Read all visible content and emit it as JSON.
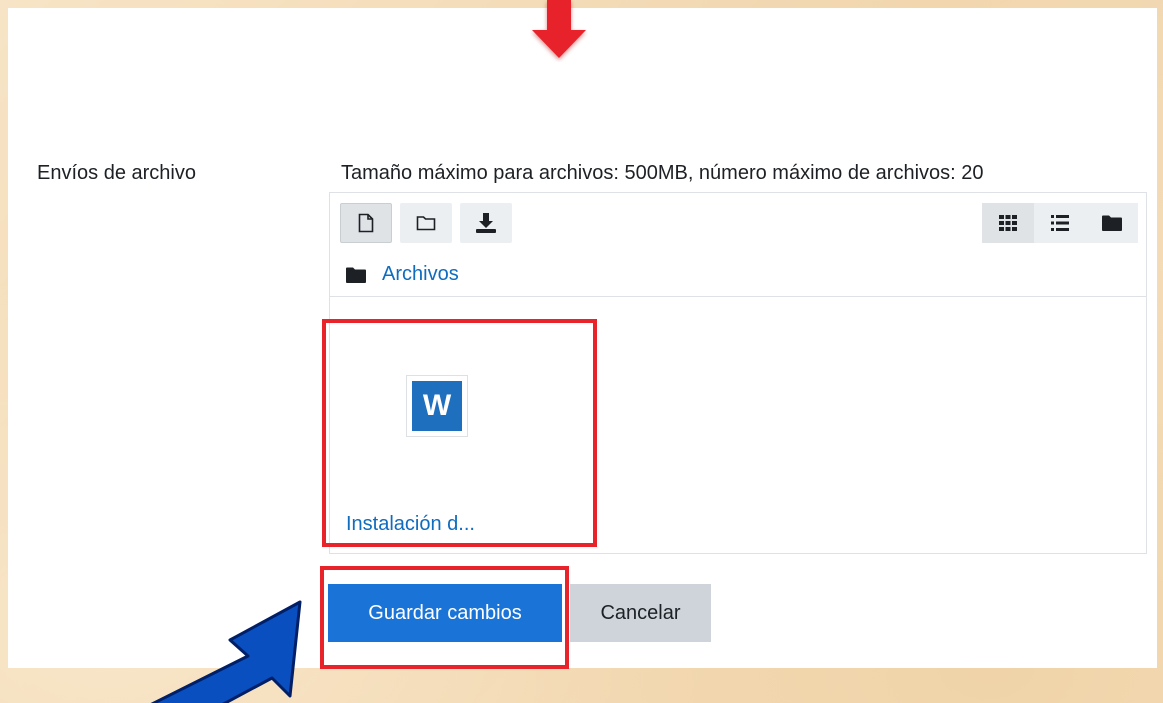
{
  "field": {
    "label": "Envíos de archivo",
    "max_info": "Tamaño máximo para archivos: 500MB, número máximo de archivos: 20"
  },
  "toolbar": {
    "buttons": [
      {
        "name": "add-file",
        "icon": "file-icon"
      },
      {
        "name": "create-folder",
        "icon": "folder-outline-icon"
      },
      {
        "name": "download-all",
        "icon": "download-icon"
      }
    ],
    "views": [
      {
        "name": "icons-view",
        "icon": "grid-icon",
        "active": true
      },
      {
        "name": "details-view",
        "icon": "list-icon",
        "active": false
      },
      {
        "name": "tree-view",
        "icon": "folder-icon",
        "active": false
      }
    ]
  },
  "breadcrumb": {
    "label": "Archivos"
  },
  "files": [
    {
      "name": "Instalación d...",
      "icon": "word-icon",
      "icon_letter": "W"
    }
  ],
  "actions": {
    "save_label": "Guardar cambios",
    "cancel_label": "Cancelar"
  },
  "colors": {
    "accent": "#1a73d6",
    "link": "#0f6cbf",
    "highlight": "#e8232a",
    "arrow_red": "#e8232a",
    "arrow_blue": "#0a4fbf"
  }
}
